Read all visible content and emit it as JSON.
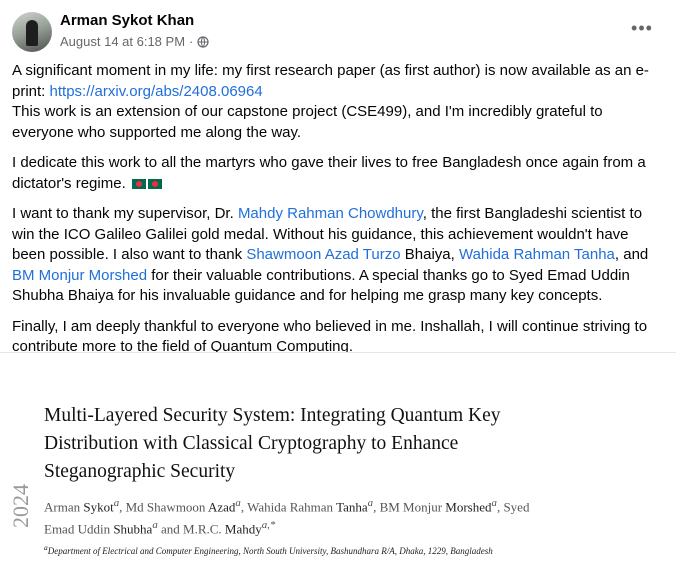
{
  "header": {
    "author": "Arman Sykot Khan",
    "timestamp": "August 14 at 6:18 PM",
    "separator": "·",
    "audience_icon": "globe-icon",
    "more_icon": "more-dots-icon",
    "more_glyph": "•••"
  },
  "post": {
    "p1_text": "A significant moment in my life: my first research paper (as first author) is now available as an e-print: ",
    "p1_link": "https://arxiv.org/abs/2408.06964",
    "p1_text2": "This work is an extension of our capstone project (CSE499), and I'm incredibly grateful to everyone who supported me along the way.",
    "p2_text": "I dedicate this work to all the martyrs who gave their lives to free Bangladesh once again from a dictator's regime. ",
    "p3_a": "I want to thank my supervisor, Dr. ",
    "p3_link_supervisor": "Mahdy Rahman Chowdhury",
    "p3_b": ", the first Bangladeshi scientist to win the ICO Galileo Galilei gold medal. Without his guidance, this achievement wouldn't have been possible. I also want to thank ",
    "p3_link_1": "Shawmoon Azad Turzo",
    "p3_c": " Bhaiya, ",
    "p3_link_2": "Wahida Rahman Tanha",
    "p3_d": ", and ",
    "p3_link_3": "BM Monjur Morshed",
    "p3_e": " for their valuable contributions. A special thanks go to Syed Emad Uddin Shubha Bhaiya for his invaluable guidance and for helping me grasp many key concepts.",
    "p4_text": "Finally, I am deeply thankful to everyone who believed in me. Inshallah, I will continue striving to contribute more to the field of Quantum Computing."
  },
  "paper": {
    "title": "Multi-Layered Security System: Integrating Quantum Key Distribution with Classical Cryptography to Enhance Steganographic Security",
    "authors_line1_a": "Arman ",
    "authors_line1_b": "Sykot",
    "authors_line1_c": "a",
    "authors_line1_d": ",  Md Shawmoon ",
    "authors_line1_e": "Azad",
    "authors_line1_f": "a",
    "authors_line1_g": ",  Wahida Rahman ",
    "authors_line1_h": "Tanha",
    "authors_line1_i": "a",
    "authors_line1_j": ",  BM Monjur ",
    "authors_line1_k": "Morshed",
    "authors_line1_l": "a",
    "authors_line1_m": ",  Syed",
    "authors_line2_a": "Emad Uddin ",
    "authors_line2_b": "Shubha",
    "authors_line2_c": "a",
    "authors_line2_d": " and  M.R.C. ",
    "authors_line2_e": "Mahdy",
    "authors_line2_f": "a,*",
    "affiliation_sup": "a",
    "affiliation": "Department of Electrical and Computer Engineering, North South University, Bashundhara R/A, Dhaka, 1229, Bangladesh",
    "side_text": "2024"
  }
}
